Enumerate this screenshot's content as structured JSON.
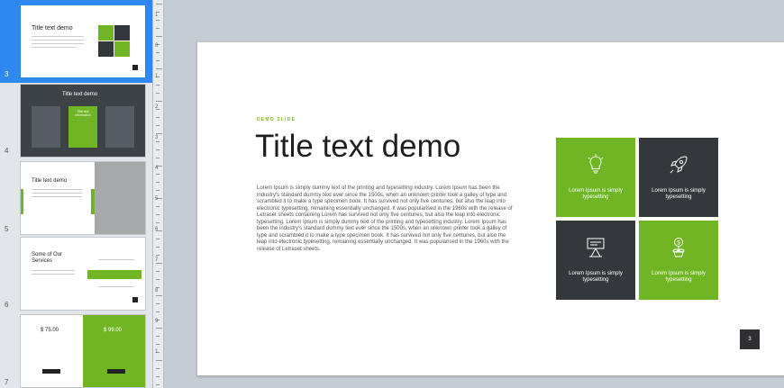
{
  "thumbnails": [
    {
      "number": "3",
      "title": "Title text demo"
    },
    {
      "number": "4",
      "title": "Title text demo",
      "col_heading": "Title text information"
    },
    {
      "number": "5",
      "title": "Title text demo"
    },
    {
      "number": "6",
      "title": "Some of Our Services"
    },
    {
      "number": "7",
      "price_left": "$ 75.00",
      "price_right": "$ 99.00"
    }
  ],
  "ruler": [
    "1",
    "0",
    "1",
    "2",
    "3",
    "4",
    "5",
    "6",
    "7",
    "8",
    "9",
    "1"
  ],
  "slide": {
    "eyebrow": "DEMO SLIDE",
    "title": "Title text demo",
    "body": "Lorem Ipsum is simply dummy text of the printing and typesetting industry. Lorem Ipsum has been the industry's standard dummy text ever since the 1500s, when an unknown printer took a galley of type and scrambled it to make a type specimen book. It has survived not only five centuries, but also the leap into electronic typesetting, remaining essentially unchanged. It was popularised in the 1960s with the release of Letraset sheets containing Lorem has survived not only five centuries, but also the leap into electronic typesetting. Lorem Ipsum is simply dummy text of the printing and typesetting industry. Lorem Ipsum has been the industry's standard dummy text ever since the 1500s, when an unknown printer took a galley of type and scrambled it to make a type specimen book. It has survived not only five centuries, but also the leap into electronic typesetting, remaining essentially unchanged. It was popularised in the 1960s with the release of Letraset sheets.",
    "tiles": [
      {
        "caption": "Lorem Ipsum is simply typesetting",
        "icon": "lightbulb-icon",
        "color": "#6fb524"
      },
      {
        "caption": "Lorem Ipsum is simply typesetting",
        "icon": "rocket-icon",
        "color": "#34373b"
      },
      {
        "caption": "Lorem Ipsum is simply typesetting",
        "icon": "presentation-icon",
        "color": "#34373b"
      },
      {
        "caption": "Lorem Ipsum is simply typesetting",
        "icon": "money-plant-icon",
        "color": "#6fb524"
      }
    ],
    "page_number": "3"
  },
  "colors": {
    "accent": "#6fb524",
    "dark": "#34373b",
    "selection": "#2f87f0"
  }
}
